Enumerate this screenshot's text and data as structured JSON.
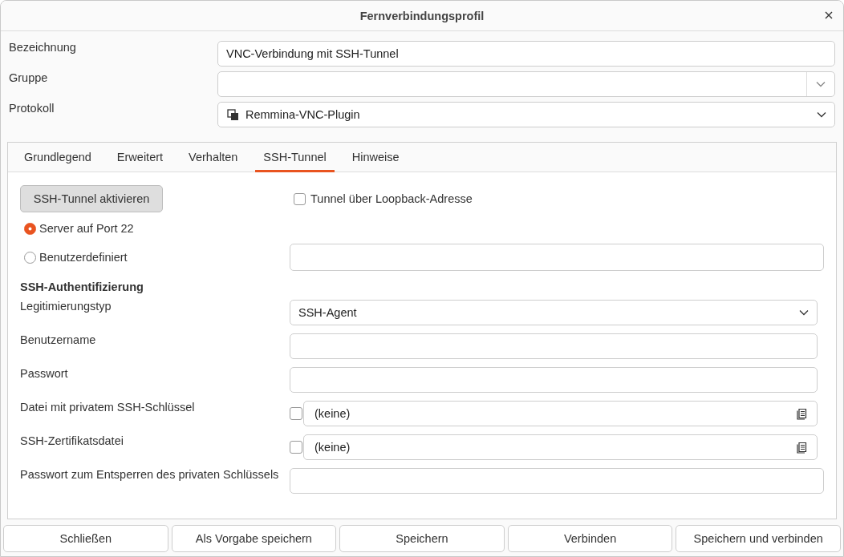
{
  "window": {
    "title": "Fernverbindungsprofil"
  },
  "fields": [
    {
      "label": "Bezeichnung",
      "kind": "text",
      "value": "VNC-Verbindung mit SSH-Tunnel"
    },
    {
      "label": "Gruppe",
      "kind": "combo"
    },
    {
      "label": "Protokoll",
      "kind": "select",
      "value": "Remmina-VNC-Plugin"
    }
  ],
  "tabs": [
    {
      "label": "Grundlegend",
      "selected": false
    },
    {
      "label": "Erweitert",
      "selected": false
    },
    {
      "label": "Verhalten",
      "selected": false
    },
    {
      "label": "SSH-Tunnel",
      "selected": true
    },
    {
      "label": "Hinweise",
      "selected": false
    }
  ],
  "ssh": {
    "enable_button": "SSH-Tunnel aktivieren",
    "loopback": {
      "label": "Tunnel über Loopback-Adresse",
      "checked": false
    },
    "server_options": [
      {
        "label": "Server auf Port 22",
        "selected": true
      },
      {
        "label": "Benutzerdefiniert",
        "selected": false
      }
    ],
    "auth_heading": "SSH-Authentifizierung",
    "auth_fields": [
      {
        "label": "Legitimierungstyp",
        "kind": "select",
        "value": "SSH-Agent"
      },
      {
        "label": "Benutzername",
        "kind": "text"
      },
      {
        "label": "Passwort",
        "kind": "text"
      },
      {
        "label": "Datei mit privatem SSH-Schlüssel",
        "kind": "file",
        "checked": false,
        "value": "(keine)"
      },
      {
        "label": "SSH-Zertifikatsdatei",
        "kind": "file",
        "checked": false,
        "value": "(keine)"
      },
      {
        "label": "Passwort zum Entsperren des privaten Schlüssels",
        "kind": "wide"
      }
    ]
  },
  "buttons": [
    "Schließen",
    "Als Vorgabe speichern",
    "Speichern",
    "Verbinden",
    "Speichern und verbinden"
  ]
}
